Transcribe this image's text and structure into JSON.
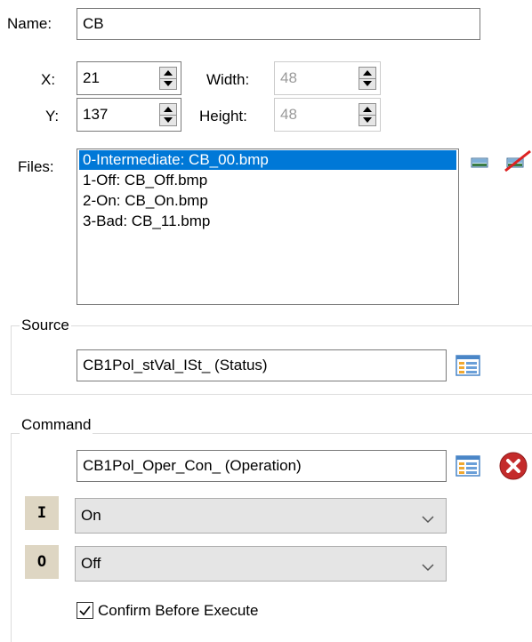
{
  "name": {
    "label": "Name:",
    "value": "CB"
  },
  "position": {
    "x_label": "X:",
    "x_value": "21",
    "y_label": "Y:",
    "y_value": "137",
    "width_label": "Width:",
    "width_value": "48",
    "height_label": "Height:",
    "height_value": "48"
  },
  "files": {
    "label": "Files:",
    "items": [
      "0-Intermediate: CB_00.bmp",
      "1-Off: CB_Off.bmp",
      "2-On: CB_On.bmp",
      "3-Bad: CB_11.bmp"
    ],
    "selected_index": 0
  },
  "source": {
    "group_title": "Source",
    "value": "CB1Pol_stVal_ISt_ (Status)"
  },
  "command": {
    "group_title": "Command",
    "value": "CB1Pol_Oper_Con_ (Operation)",
    "on_badge": "I",
    "on_value": "On",
    "off_badge": "O",
    "off_value": "Off",
    "confirm_label": "Confirm Before Execute",
    "confirm_checked": true
  },
  "icons": {
    "browse": "list-browse-icon",
    "clear": "delete-x-icon",
    "image": "image-icon",
    "remove_image": "remove-image-icon"
  },
  "colors": {
    "selection": "#0078d7",
    "delete_red": "#c42b2b",
    "badge_bg": "#ded6c3"
  }
}
